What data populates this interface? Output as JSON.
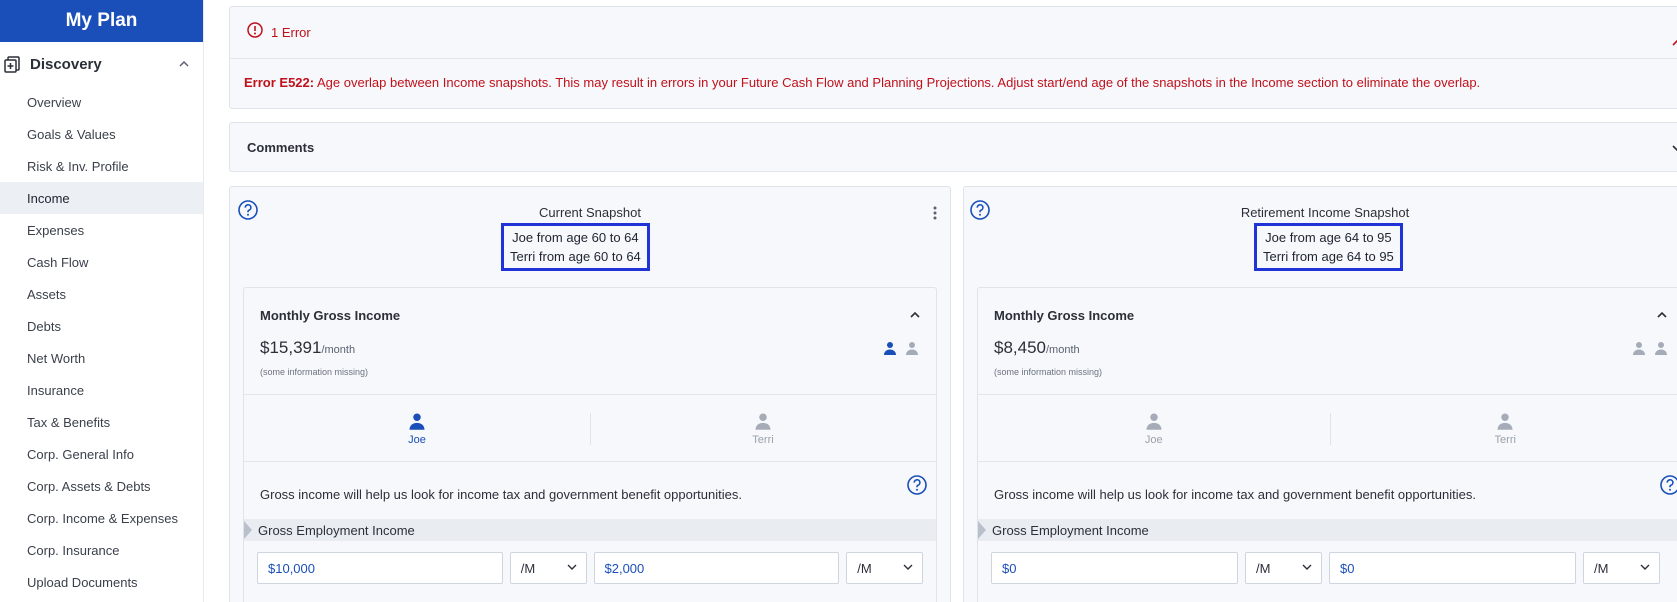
{
  "sidebar": {
    "brand": "My Plan",
    "section_label": "Discovery",
    "items": [
      {
        "label": "Overview"
      },
      {
        "label": "Goals & Values"
      },
      {
        "label": "Risk & Inv. Profile"
      },
      {
        "label": "Income",
        "active": true
      },
      {
        "label": "Expenses"
      },
      {
        "label": "Cash Flow"
      },
      {
        "label": "Assets"
      },
      {
        "label": "Debts"
      },
      {
        "label": "Net Worth"
      },
      {
        "label": "Insurance"
      },
      {
        "label": "Tax & Benefits"
      },
      {
        "label": "Corp. General Info"
      },
      {
        "label": "Corp. Assets & Debts"
      },
      {
        "label": "Corp. Income & Expenses"
      },
      {
        "label": "Corp. Insurance"
      },
      {
        "label": "Upload Documents"
      }
    ]
  },
  "error_panel": {
    "title": "1 Error",
    "code": "Error E522:",
    "message": " Age overlap between Income snapshots. This may result in errors in your Future Cash Flow and Planning Projections. Adjust start/end age of the snapshots in the Income section to eliminate the overlap."
  },
  "comments": {
    "label": "Comments"
  },
  "snapshots": [
    {
      "title": "Current Snapshot",
      "line1": "Joe from age 60 to 64",
      "line2": "Terri from age 60 to 64",
      "mgi_title": "Monthly Gross Income",
      "amount": "$15,391",
      "per": "/month",
      "missing": "(some information missing)",
      "tab_joe": "Joe",
      "tab_terri": "Terri",
      "note": "Gross income will help us look for income tax and government benefit opportunities.",
      "gei_label": "Gross Employment Income",
      "field1": "$10,000",
      "freq1": "/M",
      "field2": "$2,000",
      "freq2": "/M"
    },
    {
      "title": "Retirement Income Snapshot",
      "line1": "Joe from age 64 to 95",
      "line2": "Terri from age 64 to 95",
      "mgi_title": "Monthly Gross Income",
      "amount": "$8,450",
      "per": "/month",
      "missing": "(some information missing)",
      "tab_joe": "Joe",
      "tab_terri": "Terri",
      "note": "Gross income will help us look for income tax and government benefit opportunities.",
      "gei_label": "Gross Employment Income",
      "field1": "$0",
      "freq1": "/M",
      "field2": "$0",
      "freq2": "/M"
    }
  ],
  "colors": {
    "brand": "#1a4fba",
    "error": "#c0111b",
    "highlight_box": "#1f33d6"
  }
}
